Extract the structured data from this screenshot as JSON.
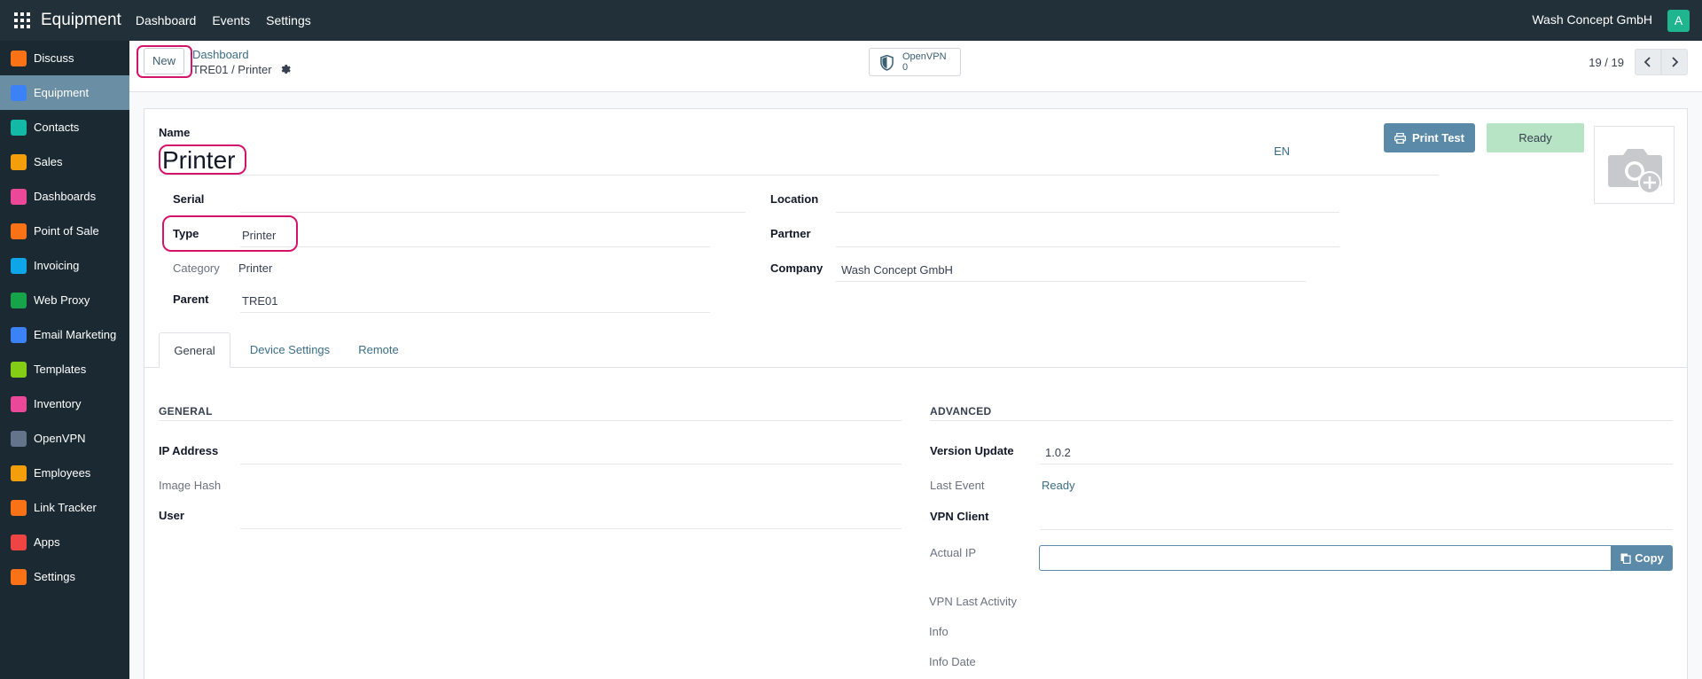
{
  "navbar": {
    "app_title": "Equipment",
    "menu": [
      "Dashboard",
      "Events",
      "Settings"
    ],
    "company": "Wash Concept GmbH",
    "avatar_letter": "A"
  },
  "sidebar": {
    "items": [
      {
        "label": "Discuss",
        "icon": "discuss-icon",
        "color": "#f97316"
      },
      {
        "label": "Equipment",
        "icon": "equipment-icon",
        "color": "#3b82f6",
        "active": true
      },
      {
        "label": "Contacts",
        "icon": "contacts-icon",
        "color": "#14b8a6"
      },
      {
        "label": "Sales",
        "icon": "sales-icon",
        "color": "#f59e0b"
      },
      {
        "label": "Dashboards",
        "icon": "dashboards-icon",
        "color": "#ec4899"
      },
      {
        "label": "Point of Sale",
        "icon": "point-of-sale-icon",
        "color": "#f97316"
      },
      {
        "label": "Invoicing",
        "icon": "invoicing-icon",
        "color": "#0ea5e9"
      },
      {
        "label": "Web Proxy",
        "icon": "web-proxy-icon",
        "color": "#16a34a"
      },
      {
        "label": "Email Marketing",
        "icon": "email-marketing-icon",
        "color": "#3b82f6"
      },
      {
        "label": "Templates",
        "icon": "templates-icon",
        "color": "#84cc16"
      },
      {
        "label": "Inventory",
        "icon": "inventory-icon",
        "color": "#ec4899"
      },
      {
        "label": "OpenVPN",
        "icon": "openvpn-icon",
        "color": "#64748b"
      },
      {
        "label": "Employees",
        "icon": "employees-icon",
        "color": "#f59e0b"
      },
      {
        "label": "Link Tracker",
        "icon": "link-tracker-icon",
        "color": "#f97316"
      },
      {
        "label": "Apps",
        "icon": "apps-icon",
        "color": "#ef4444"
      },
      {
        "label": "Settings",
        "icon": "settings-icon",
        "color": "#f97316"
      }
    ]
  },
  "control": {
    "new_label": "New",
    "breadcrumb_parent": "Dashboard",
    "breadcrumb_current": "TRE01 / Printer",
    "smart_button_label": "OpenVPN",
    "smart_button_count": "0",
    "pager": "19 / 19"
  },
  "form": {
    "name_label": "Name",
    "name_value": "Printer",
    "lang": "EN",
    "print_test_label": "Print Test",
    "status": "Ready",
    "fields": {
      "serial_label": "Serial",
      "type_label": "Type",
      "type_value": "Printer",
      "category_label": "Category",
      "category_value": "Printer",
      "parent_label": "Parent",
      "parent_value": "TRE01",
      "location_label": "Location",
      "partner_label": "Partner",
      "company_label": "Company",
      "company_value": "Wash Concept GmbH"
    },
    "tabs": [
      "General",
      "Device Settings",
      "Remote"
    ],
    "general": {
      "title": "GENERAL",
      "ip_label": "IP Address",
      "hash_label": "Image Hash",
      "user_label": "User"
    },
    "advanced": {
      "title": "ADVANCED",
      "version_label": "Version Update",
      "version_value": "1.0.2",
      "last_event_label": "Last Event",
      "last_event_value": "Ready",
      "vpn_client_label": "VPN Client",
      "actual_ip_label": "Actual IP",
      "actual_ip_value": "",
      "copy_label": "Copy",
      "vpn_last_activity_label": "VPN Last Activity",
      "info_label": "Info",
      "info_date_label": "Info Date"
    }
  }
}
